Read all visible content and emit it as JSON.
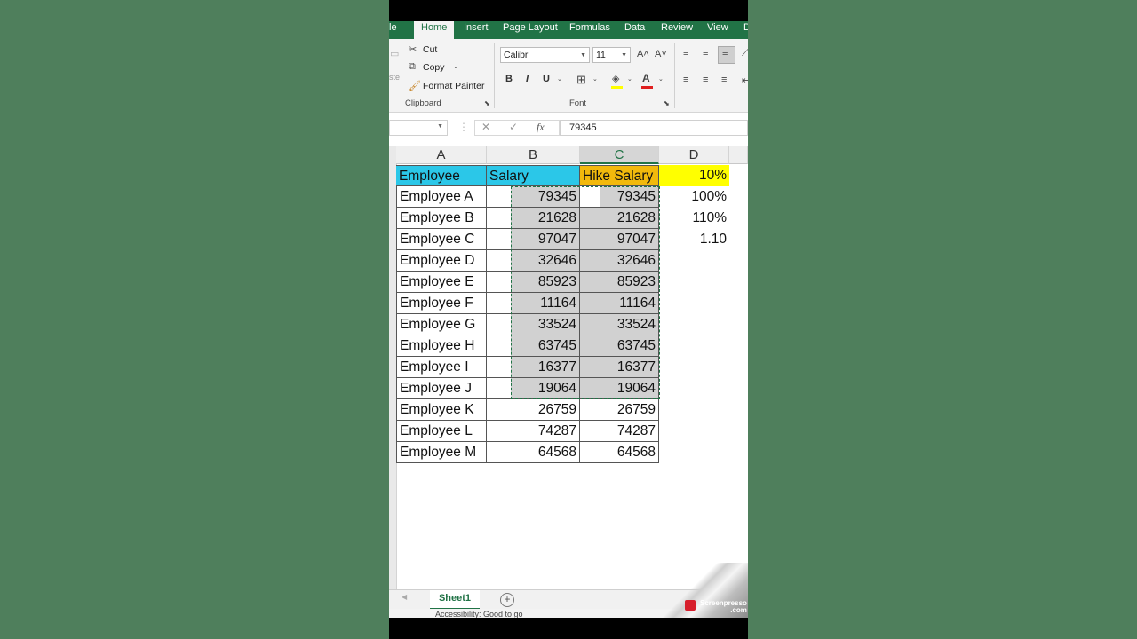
{
  "tabs": [
    {
      "label": "le"
    },
    {
      "label": "Home"
    },
    {
      "label": "Insert"
    },
    {
      "label": "Page Layout"
    },
    {
      "label": "Formulas"
    },
    {
      "label": "Data"
    },
    {
      "label": "Review"
    },
    {
      "label": "View"
    },
    {
      "label": "D"
    }
  ],
  "ribbon": {
    "cut": "Cut",
    "copy": "Copy",
    "format_painter": "Format Painter",
    "paste_partial": "ste",
    "clipboard_group": "Clipboard",
    "font_name": "Calibri",
    "font_size": "11",
    "font_group": "Font",
    "bold": "B",
    "italic": "I",
    "underline": "U",
    "grow_font": "A˄",
    "shrink_font": "A˅"
  },
  "formula_bar": {
    "value": "79345",
    "fx": "fx"
  },
  "columns": [
    "A",
    "B",
    "C",
    "D"
  ],
  "header_row": {
    "a": "Employee",
    "b": "Salary",
    "c": "Hike Salary",
    "d": "10%"
  },
  "rows": [
    {
      "name": "Employee A",
      "salary": "79345",
      "hike": "79345",
      "d": "100%"
    },
    {
      "name": "Employee B",
      "salary": "21628",
      "hike": "21628",
      "d": "110%"
    },
    {
      "name": "Employee C",
      "salary": "97047",
      "hike": "97047",
      "d": "1.10"
    },
    {
      "name": "Employee D",
      "salary": "32646",
      "hike": "32646",
      "d": ""
    },
    {
      "name": "Employee E",
      "salary": "85923",
      "hike": "85923",
      "d": ""
    },
    {
      "name": "Employee F",
      "salary": "11164",
      "hike": "11164",
      "d": ""
    },
    {
      "name": "Employee G",
      "salary": "33524",
      "hike": "33524",
      "d": ""
    },
    {
      "name": "Employee H",
      "salary": "63745",
      "hike": "63745",
      "d": ""
    },
    {
      "name": "Employee I",
      "salary": "16377",
      "hike": "16377",
      "d": ""
    },
    {
      "name": "Employee J",
      "salary": "19064",
      "hike": "19064",
      "d": ""
    },
    {
      "name": "Employee K",
      "salary": "26759",
      "hike": "26759",
      "d": ""
    },
    {
      "name": "Employee L",
      "salary": "74287",
      "hike": "74287",
      "d": ""
    },
    {
      "name": "Employee M",
      "salary": "64568",
      "hike": "64568",
      "d": ""
    }
  ],
  "sheet": {
    "name": "Sheet1",
    "add": "+"
  },
  "status": {
    "text": "Accessibility: Good to go"
  },
  "watermark": {
    "line1": "Screenpresso",
    "line2": ".com"
  },
  "colors": {
    "excel_green": "#217346",
    "header_cyan": "#2bc7e8",
    "header_gold": "#f2b90c",
    "yellow": "#ffff00",
    "selection_gray": "#d1d1d1"
  }
}
